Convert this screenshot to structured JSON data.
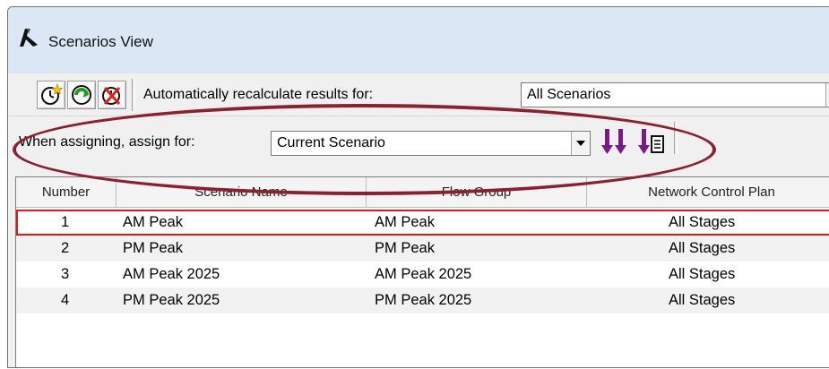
{
  "window": {
    "title": "Scenarios View"
  },
  "toolbar1": {
    "buttons": [
      {
        "icon": "new-scenario-clock-icon"
      },
      {
        "icon": "refresh-green-icon"
      },
      {
        "icon": "delete-scenario-icon"
      }
    ],
    "recalc_label": "Automatically recalculate results for:",
    "recalc_value": "All Scenarios"
  },
  "toolbar2": {
    "assign_label": "When assigning, assign for:",
    "assign_value": "Current Scenario",
    "buttons": [
      {
        "icon": "assign-down-arrows-icon"
      },
      {
        "icon": "assign-report-icon"
      }
    ]
  },
  "grid": {
    "columns": [
      "Number",
      "Scenario Name",
      "Flow Group",
      "Network Control Plan"
    ],
    "rows": [
      {
        "number": "1",
        "name": "AM Peak",
        "flow_group": "AM Peak",
        "control_plan": "All Stages"
      },
      {
        "number": "2",
        "name": "PM Peak",
        "flow_group": "PM Peak",
        "control_plan": "All Stages"
      },
      {
        "number": "3",
        "name": "AM Peak 2025",
        "flow_group": "AM Peak 2025",
        "control_plan": "All Stages"
      },
      {
        "number": "4",
        "name": "PM Peak 2025",
        "flow_group": "PM Peak 2025",
        "control_plan": "All Stages"
      }
    ]
  },
  "colors": {
    "highlight_ellipse": "#8c2030",
    "selected_row_border": "#e01818",
    "arrow_purple": "#7a1a86"
  }
}
